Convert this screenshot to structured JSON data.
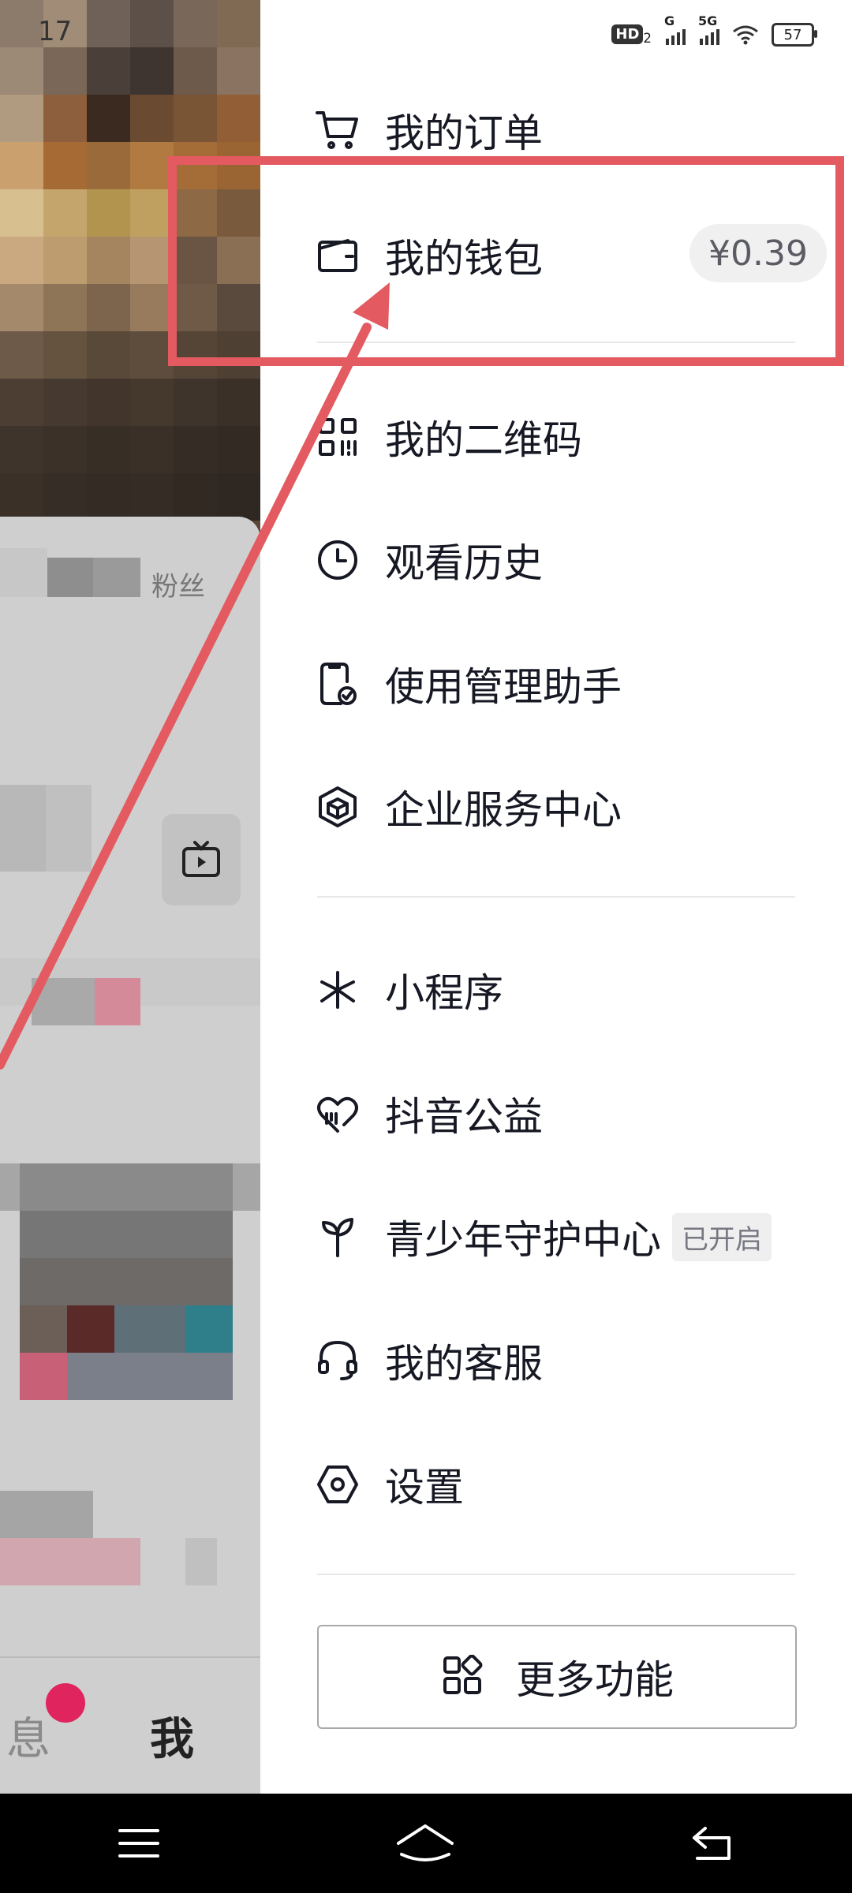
{
  "status_bar": {
    "time": "17",
    "hd_label": "HD",
    "hd_sub": "2",
    "net1": "G",
    "net2": "5G",
    "battery": "57"
  },
  "background": {
    "fans_label": "粉丝",
    "tab_me": "我",
    "tab_msg": "息"
  },
  "menu": {
    "orders": "我的订单",
    "wallet": "我的钱包",
    "wallet_amount": "¥0.39",
    "qrcode": "我的二维码",
    "history": "观看历史",
    "usage_helper": "使用管理助手",
    "enterprise": "企业服务中心",
    "mini_programs": "小程序",
    "charity": "抖音公益",
    "youth_center": "青少年守护中心",
    "youth_badge": "已开启",
    "customer_service": "我的客服",
    "settings": "设置",
    "more": "更多功能"
  },
  "colors": {
    "annotation": "#e35a61",
    "text": "#161823",
    "nav_bar": "#000000"
  }
}
